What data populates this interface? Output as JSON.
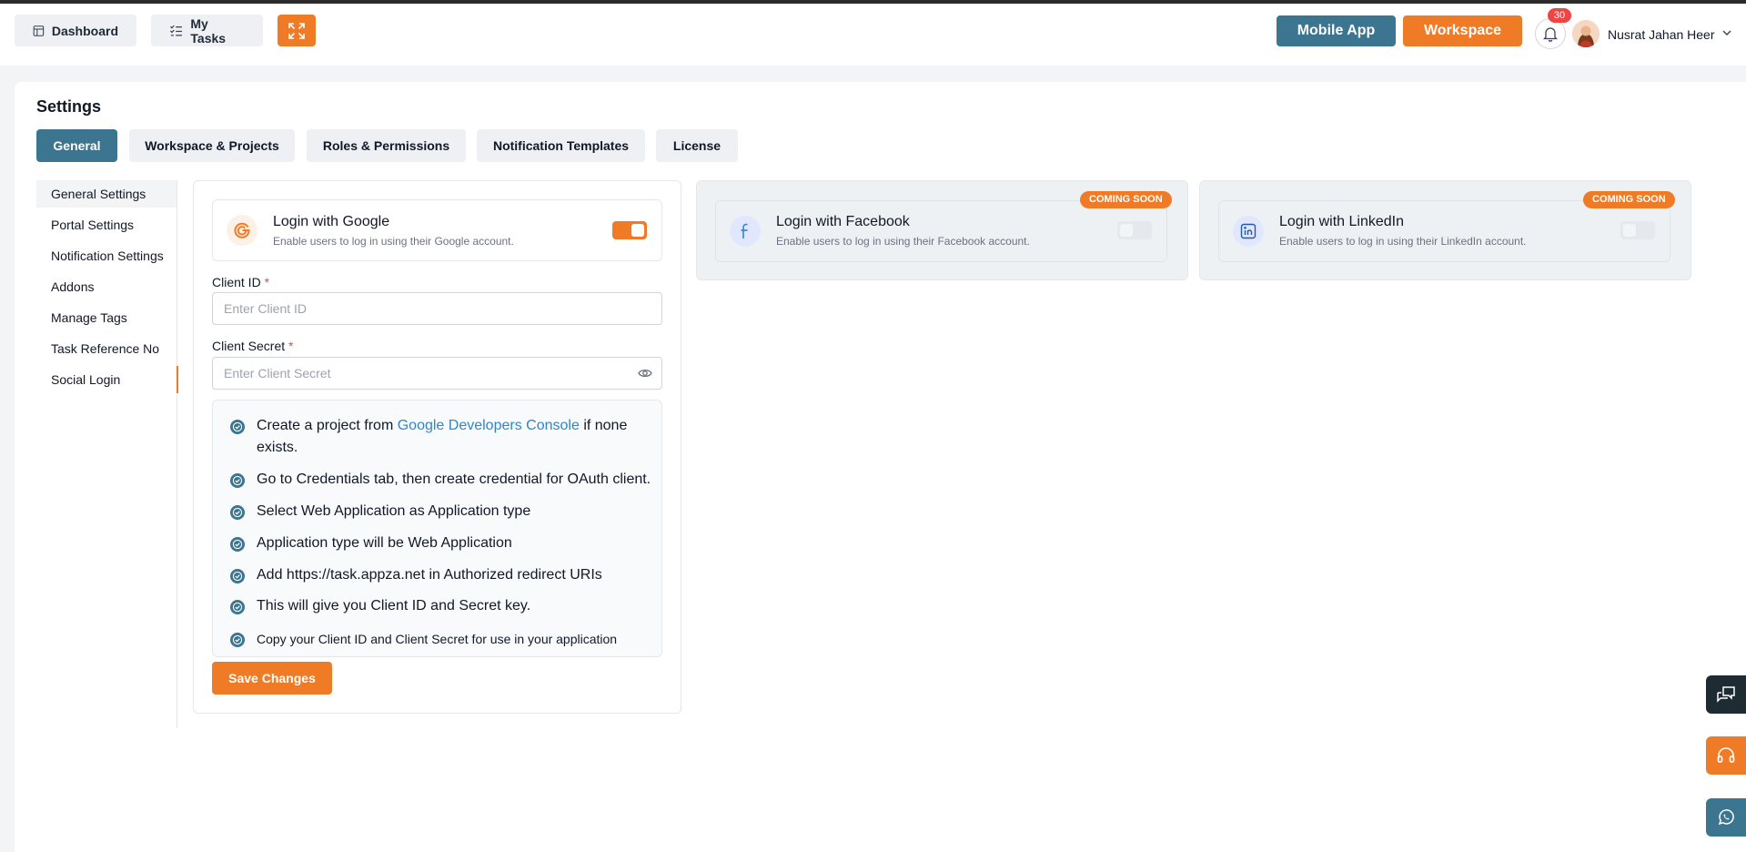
{
  "header": {
    "dashboard_label": "Dashboard",
    "my_tasks_label": "My Tasks",
    "mobile_app_label": "Mobile App",
    "workspace_label": "Workspace",
    "notification_count": "30",
    "user_name": "Nusrat Jahan Heer"
  },
  "page": {
    "title": "Settings"
  },
  "tabs": [
    {
      "label": "General"
    },
    {
      "label": "Workspace & Projects"
    },
    {
      "label": "Roles & Permissions"
    },
    {
      "label": "Notification Templates"
    },
    {
      "label": "License"
    }
  ],
  "sidebar": {
    "items": [
      {
        "label": "General Settings"
      },
      {
        "label": "Portal Settings"
      },
      {
        "label": "Notification Settings"
      },
      {
        "label": "Addons"
      },
      {
        "label": "Manage Tags"
      },
      {
        "label": "Task Reference No"
      },
      {
        "label": "Social Login"
      }
    ]
  },
  "google": {
    "title": "Login with Google",
    "description": "Enable users to log in using their Google account.",
    "enabled": true,
    "client_id_label": "Client ID",
    "client_id_placeholder": "Enter Client ID",
    "client_secret_label": "Client Secret",
    "client_secret_placeholder": "Enter Client Secret",
    "required_mark": "*",
    "steps": {
      "s1_prefix": "Create a project from",
      "s1_link": "Google Developers Console",
      "s1_suffix": "if none exists.",
      "s2": "Go to Credentials tab, then create credential for OAuth client.",
      "s3": "Select Web Application as Application type",
      "s4": "Application type will be Web Application",
      "s5": "Add https://task.appza.net in Authorized redirect URIs",
      "s6": "This will give you Client ID and Secret key.",
      "s7": "Copy your Client ID and Client Secret for use in your application"
    },
    "save_label": "Save Changes"
  },
  "facebook": {
    "title": "Login with Facebook",
    "description": "Enable users to log in using their Facebook account.",
    "badge": "COMING SOON"
  },
  "linkedin": {
    "title": "Login with LinkedIn",
    "description": "Enable users to log in using their LinkedIn account.",
    "badge": "COMING SOON"
  },
  "colors": {
    "accent": "#f07b26",
    "primary": "#3b7590",
    "dark": "#1d2b33"
  }
}
